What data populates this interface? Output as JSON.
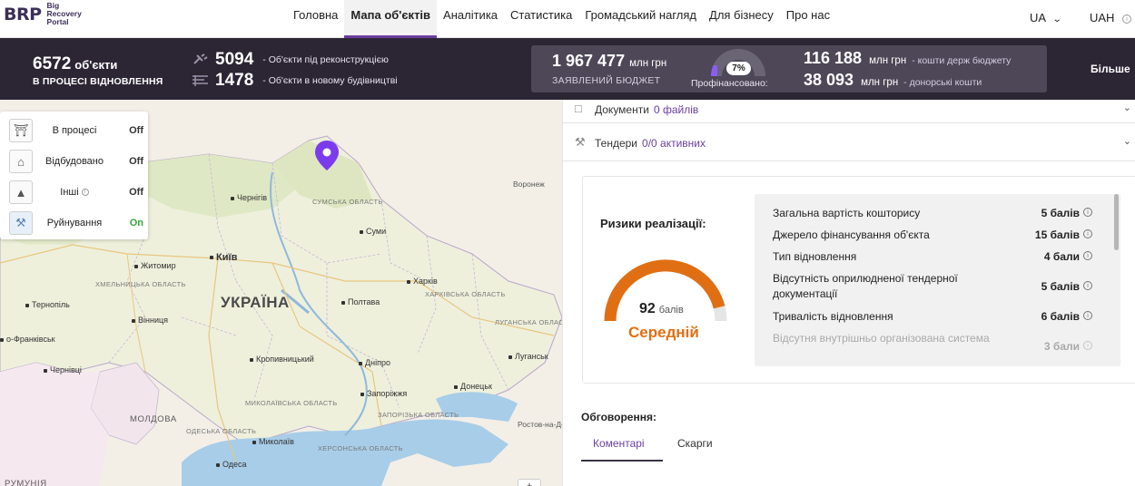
{
  "header": {
    "logo_mark": "BRP",
    "logo_text_1": "Big",
    "logo_text_2": "Recovery",
    "logo_text_3": "Portal",
    "nav": [
      "Головна",
      "Мапа об'єктів",
      "Аналітика",
      "Статистика",
      "Громадський нагляд",
      "Для бізнесу",
      "Про нас"
    ],
    "active_nav": "Мапа об'єктів",
    "lang": "UA",
    "currency": "UAH"
  },
  "stats": {
    "total_num": "6572",
    "total_unit": "об'єкти",
    "total_sub": "В ПРОЦЕСІ ВІДНОВЛЕННЯ",
    "reconstruction_num": "5094",
    "reconstruction_lbl": "- Об'єкти під реконструкцією",
    "new_num": "1478",
    "new_lbl": "- Об'єкти в новому будівництві",
    "budget_num": "1 967 477",
    "budget_unit": "млн грн",
    "budget_sub": "ЗАЯВЛЕНИЙ БЮДЖЕТ",
    "financed_pct": "7%",
    "financed_fraction": 0.07,
    "financed_lbl": "Профінансовано:",
    "state_num": "116 188",
    "state_unit": "млн грн",
    "state_lbl": "- кошти держ бюджету",
    "donor_num": "38 093",
    "donor_unit": "млн грн",
    "donor_lbl": "- донорські кошти",
    "more": "Більше"
  },
  "legend": {
    "items": [
      {
        "label": "В процесі",
        "state": "Off",
        "icon": "building-crane-icon"
      },
      {
        "label": "Відбудовано",
        "state": "Off",
        "icon": "house-icon"
      },
      {
        "label": "Інші",
        "state": "Off",
        "icon": "tree-icon"
      },
      {
        "label": "Руйнування",
        "state": "On",
        "icon": "destroyed-building-icon"
      }
    ]
  },
  "map": {
    "country": "УКРАЇНА",
    "cities": {
      "kyiv": "Київ",
      "chernihiv": "Чернігів",
      "sumy": "Суми",
      "kharkiv": "Харків",
      "poltava": "Полтава",
      "zhytomyr": "Житомир",
      "vinnytsia": "Вінниця",
      "ternopil": "Тернопіль",
      "frankivsk": "о-Франківськ",
      "chernivtsi": "Чернівці",
      "dnipro": "Дніпро",
      "zaporizhzhia": "Запоріжжя",
      "donetsk": "Донецьк",
      "luhansk": "Луганськ",
      "kropyvnytskyi": "Кропивницький",
      "odesa": "Одеса",
      "mykolaiv": "Миколаїв",
      "voronezh": "Воронеж",
      "rostov": "Ростов-на-Дону",
      "moldova": "МОЛДОВА",
      "romania": "РУМУНІЯ"
    },
    "regions": {
      "sumy": "СУМСЬКА ОБЛАСТЬ",
      "kharkiv": "ХАРКІВСЬКА ОБЛАСТЬ",
      "luhansk": "ЛУГАНСЬКА ОБЛАСТЬ",
      "khmelnytskyi": "ХМЕЛЬНИЦЬКА ОБЛАСТЬ",
      "mykolaiv": "МИКОЛАЇВСЬКА ОБЛАСТЬ",
      "zaporizhzhia": "ЗАПОРІЗЬКА ОБЛАСТЬ",
      "odesa": "ОДЕСЬКА ОБЛАСТЬ",
      "kherson": "ХЕРСОНСЬКА ОБЛАСТЬ"
    },
    "zoom_label": "+"
  },
  "panel": {
    "documents_label": "Документи",
    "documents_count": "0 файлів",
    "tenders_label": "Тендери",
    "tenders_count": "0/0 активних",
    "risk_title": "Ризики реалізації:",
    "risk_score": "92",
    "risk_score_unit": "балів",
    "risk_level": "Середній",
    "risk_gauge_fraction": 0.92,
    "risk_items": [
      {
        "name": "Загальна вартість кошторису",
        "value": "5 балів"
      },
      {
        "name": "Джерело фінансування об'єкта",
        "value": "15 балів"
      },
      {
        "name": "Тип відновлення",
        "value": "4 бали"
      },
      {
        "name": "Відсутність оприлюдненої тендерної документації",
        "value": "5 балів"
      },
      {
        "name": "Тривалість відновлення",
        "value": "6 балів"
      },
      {
        "name": "Відсутня внутрішньо організована система",
        "value": "3 бали"
      }
    ],
    "comments_title": "Обговорення:",
    "tabs": [
      "Коментарі",
      "Скарги"
    ]
  },
  "colors": {
    "accent": "#6b3fa0",
    "dark_bar": "#2b2534",
    "risk_orange": "#e06f13",
    "on_green": "#2fa83a"
  }
}
